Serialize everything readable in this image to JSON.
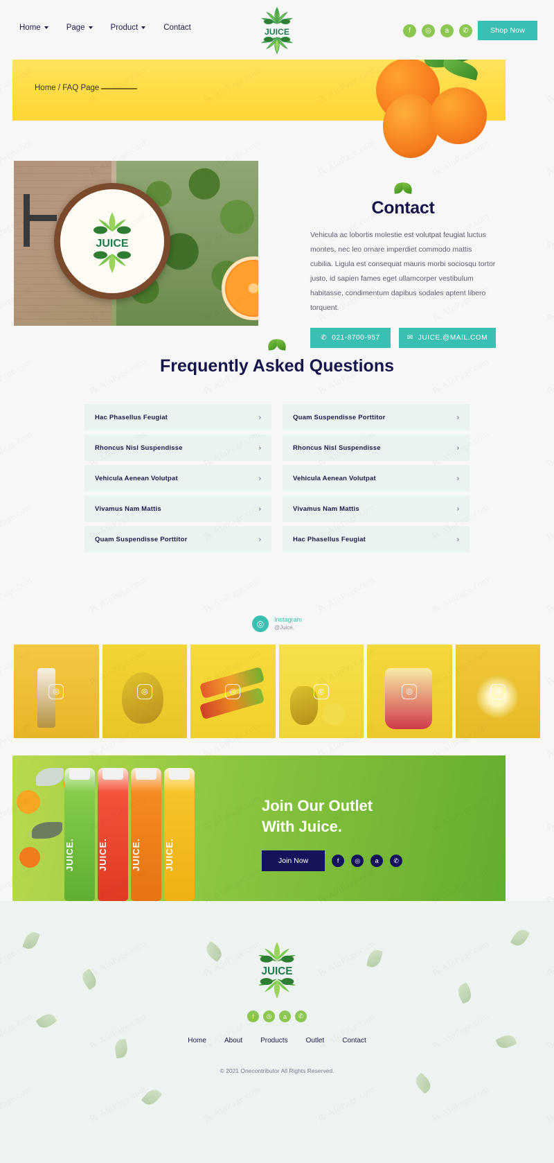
{
  "brand": {
    "name": "JUICE",
    "logo_alt": "juice-leaf-emblem"
  },
  "header": {
    "nav": [
      {
        "label": "Home",
        "has_dropdown": true
      },
      {
        "label": "Page",
        "has_dropdown": true
      },
      {
        "label": "Product",
        "has_dropdown": true
      },
      {
        "label": "Contact",
        "has_dropdown": false
      }
    ],
    "social": [
      {
        "name": "facebook-icon",
        "glyph": "f"
      },
      {
        "name": "instagram-icon",
        "glyph": "◎"
      },
      {
        "name": "amazon-icon",
        "glyph": "a"
      },
      {
        "name": "whatsapp-icon",
        "glyph": "✆"
      }
    ],
    "cta_label": "Shop Now"
  },
  "breadcrumb": {
    "text": "Home / FAQ Page"
  },
  "contact": {
    "eyebrow_icon": "leaf-icon",
    "title": "Contact",
    "body": "Vehicula ac lobortis molestie est volutpat feugiat luctus montes, nec leo ornare imperdiet commodo mattis cubilia. Ligula est consequat mauris morbi sociosqu tortor justo, id sapien fames eget ullamcorper vestibulum habitasse, condimentum dapibus sodales aptent libero torquent.",
    "phone_label": "021-8700-957",
    "email_label": "JUICE.@MAIL.COM"
  },
  "faq": {
    "title": "Frequently Asked Questions",
    "left": [
      "Hac Phasellus Feugiat",
      "Rhoncus Nisl Suspendisse",
      "Vehicula Aenean Volutpat",
      "Vivamus Nam Mattis",
      "Quam Suspendisse Porttitor"
    ],
    "right": [
      "Quam Suspendisse Porttitor",
      "Rhoncus Nisl Suspendisse",
      "Vehicula Aenean Volutpat",
      "Vivamus Nam Mattis",
      "Hac Phasellus Feugiat"
    ],
    "chevron": "›"
  },
  "instagram": {
    "icon": "instagram-icon",
    "title": "Instagram",
    "handle": "@Juice.",
    "tiles": [
      {
        "alt": "layered-juice-glass-with-spoon"
      },
      {
        "alt": "pineapple-wearing-sunglasses"
      },
      {
        "alt": "row-of-juice-bottles"
      },
      {
        "alt": "pineapple-and-lemons"
      },
      {
        "alt": "fruit-infused-pitcher"
      },
      {
        "alt": "lemon-slice-in-glass"
      }
    ]
  },
  "outlet": {
    "heading_line1": "Join Our Outlet",
    "heading_line2": "With Juice.",
    "cta_label": "Join Now",
    "social": [
      {
        "name": "facebook-icon",
        "glyph": "f"
      },
      {
        "name": "instagram-icon",
        "glyph": "◎"
      },
      {
        "name": "amazon-icon",
        "glyph": "a"
      },
      {
        "name": "whatsapp-icon",
        "glyph": "✆"
      }
    ],
    "bottles": [
      {
        "label": "JUICE.",
        "flavor": "green"
      },
      {
        "label": "JUICE.",
        "flavor": "red"
      },
      {
        "label": "JUICE.",
        "flavor": "orange"
      },
      {
        "label": "JUICE.",
        "flavor": "yellow"
      }
    ]
  },
  "footer": {
    "social": [
      {
        "name": "facebook-icon",
        "glyph": "f"
      },
      {
        "name": "instagram-icon",
        "glyph": "◎"
      },
      {
        "name": "amazon-icon",
        "glyph": "a"
      },
      {
        "name": "whatsapp-icon",
        "glyph": "✆"
      }
    ],
    "nav": [
      "Home",
      "About",
      "Products",
      "Outlet",
      "Contact"
    ],
    "copyright": "© 2021 Onecontributor All Rights Reserved."
  },
  "watermark": {
    "text": "AloPage.com"
  },
  "colors": {
    "accent_teal": "#3bbfb2",
    "accent_green": "#8cc751",
    "navy": "#15154a",
    "band_yellow": "#ffd633",
    "faq_bg": "#e9f3f0",
    "footer_bg": "#edf3f1"
  }
}
